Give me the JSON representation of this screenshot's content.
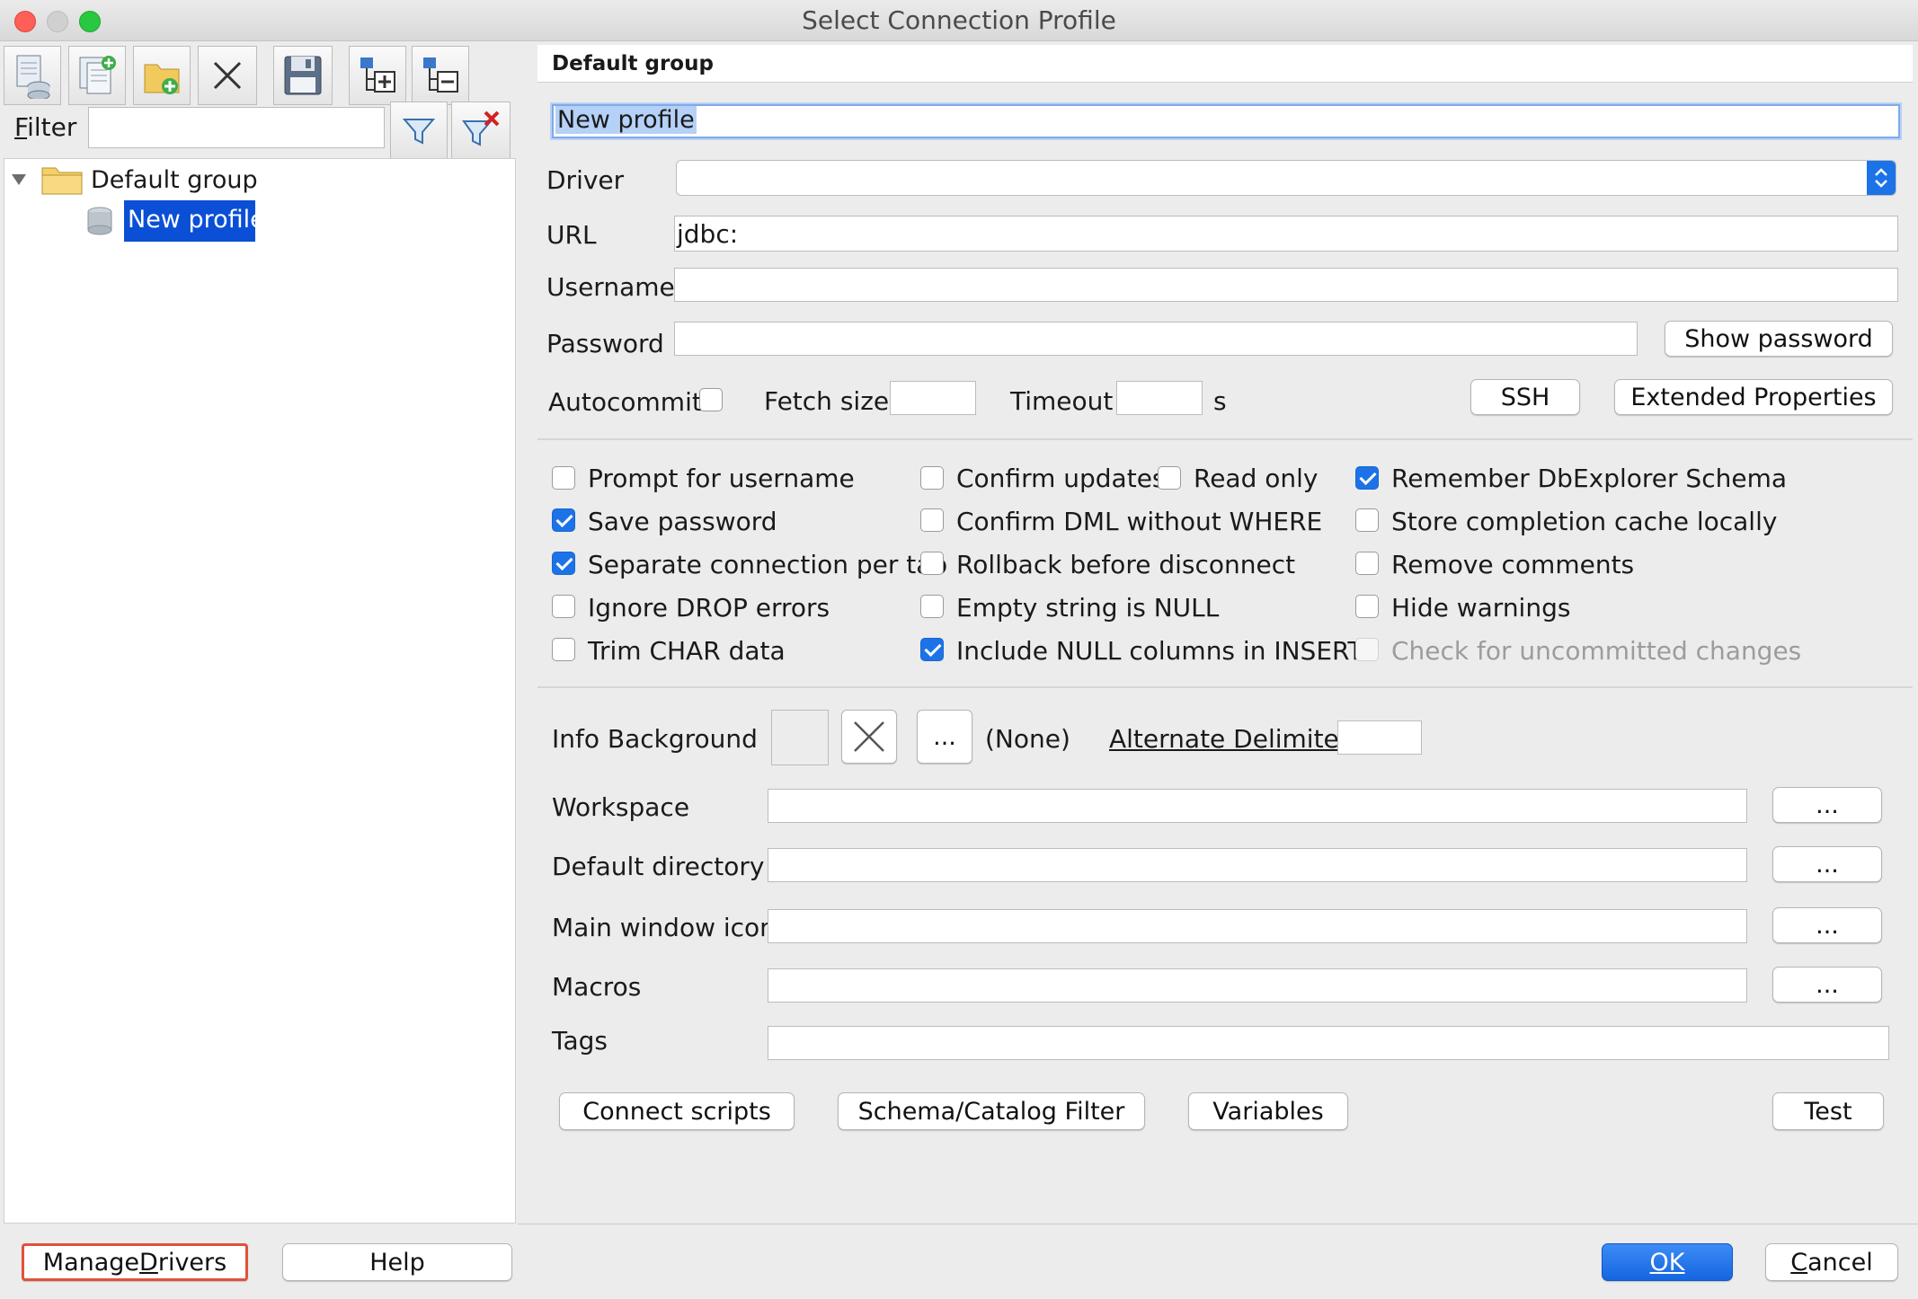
{
  "window": {
    "title": "Select Connection Profile"
  },
  "toolbar": {
    "icons": [
      "new-profile-icon",
      "copy-profile-icon",
      "new-group-icon",
      "delete-icon",
      "save-icon",
      "expand-tree-icon",
      "collapse-tree-icon"
    ]
  },
  "filter": {
    "label": "Filter",
    "label_mnemonic": "F",
    "label_rest": "ilter",
    "value": ""
  },
  "tree": {
    "group": "Default group",
    "profile": "New profile"
  },
  "header": {
    "group_title": "Default group"
  },
  "profile": {
    "name": "New profile",
    "driver": "",
    "url": "jdbc:",
    "username": "",
    "password": ""
  },
  "labels": {
    "driver": "Driver",
    "url": "URL",
    "username": "Username",
    "password": "Password",
    "autocommit": "Autocommit",
    "fetch_size": "Fetch size",
    "timeout": "Timeout",
    "seconds": "s"
  },
  "buttons": {
    "show_password": "Show password",
    "ssh": "SSH",
    "extended_properties": "Extended Properties",
    "connect_scripts": "Connect scripts",
    "schema_filter": "Schema/Catalog Filter",
    "variables": "Variables",
    "test": "Test",
    "browse": "..."
  },
  "options": {
    "col1": [
      {
        "label": "Prompt for username",
        "checked": false
      },
      {
        "label": "Save password",
        "checked": true
      },
      {
        "label": "Separate connection per tab",
        "checked": true
      },
      {
        "label": "Ignore DROP errors",
        "checked": false
      },
      {
        "label": "Trim CHAR data",
        "checked": false
      }
    ],
    "col2": [
      {
        "label": "Confirm updates",
        "checked": false
      },
      {
        "label": "Confirm DML without WHERE",
        "checked": false
      },
      {
        "label": "Rollback before disconnect",
        "checked": false
      },
      {
        "label": "Empty string is NULL",
        "checked": false
      },
      {
        "label": "Include NULL columns in INSERTs",
        "checked": true
      }
    ],
    "read_only": {
      "label": "Read only",
      "checked": false
    },
    "col3": [
      {
        "label": "Remember DbExplorer Schema",
        "checked": true
      },
      {
        "label": "Store completion cache locally",
        "checked": false
      },
      {
        "label": "Remove comments",
        "checked": false
      },
      {
        "label": "Hide warnings",
        "checked": false
      },
      {
        "label": "Check for uncommitted changes",
        "checked": false,
        "disabled": true
      }
    ]
  },
  "extra": {
    "info_background": "Info Background",
    "color_value": "(None)",
    "alternate_delimiter": "Alternate Delimiter",
    "workspace": "Workspace",
    "default_directory": "Default directory",
    "main_window_icon": "Main window icon",
    "macros": "Macros",
    "tags": "Tags"
  },
  "footer": {
    "manage_drivers": "Manage Drivers",
    "manage_pre": "Manage ",
    "manage_mn": "D",
    "manage_post": "rivers",
    "help": "Help",
    "ok": "OK",
    "cancel": "Cancel",
    "cancel_mn": "C",
    "cancel_rest": "ancel"
  },
  "colors": {
    "accent": "#1c73e8",
    "selection": "#0a4fd6",
    "focus_border": "#e0523a"
  }
}
